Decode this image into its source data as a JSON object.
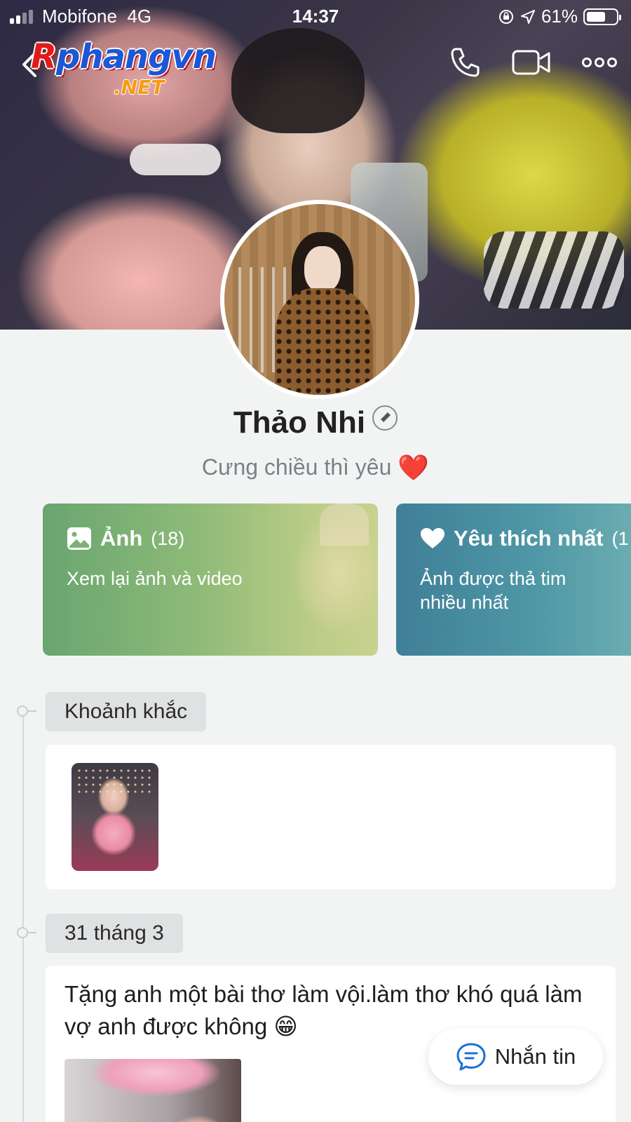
{
  "status_bar": {
    "carrier": "Mobifone",
    "network": "4G",
    "time": "14:37",
    "battery": "61%",
    "battery_level": 0.61,
    "signal_bars": 2
  },
  "watermark": {
    "top": "Rphangvn",
    "top_first": "R",
    "top_rest": "phangvn",
    "bottom": ".NET"
  },
  "nav": {
    "icons": [
      "back-icon",
      "phone-icon",
      "video-call-icon",
      "more-icon"
    ]
  },
  "profile": {
    "name": "Thảo Nhi",
    "bio": "Cưng chiều thì yêu",
    "bio_emoji": "❤️"
  },
  "cards": {
    "photos": {
      "title": "Ảnh",
      "count": "(18)",
      "subtitle": "Xem lại ảnh và video",
      "icon": "image-icon"
    },
    "favorites": {
      "title": "Yêu thích nhất",
      "count": "(1",
      "subtitle": "Ảnh được thả tim nhiều nhất",
      "icon": "heart-icon"
    }
  },
  "timeline": {
    "moments_label": "Khoảnh khắc",
    "date_label": "31 tháng 3",
    "post_text": "Tặng anh một bài thơ làm vội.làm thơ khó quá làm vợ anh được không 😁"
  },
  "message_button": {
    "label": "Nhắn tin",
    "icon": "chat-bubble-icon"
  },
  "colors": {
    "photos_card": "#7fb174",
    "favorites_card": "#4a8ea2",
    "background": "#f2f4f4",
    "heart": "#e3222e",
    "chat_icon": "#1c6fd6"
  }
}
